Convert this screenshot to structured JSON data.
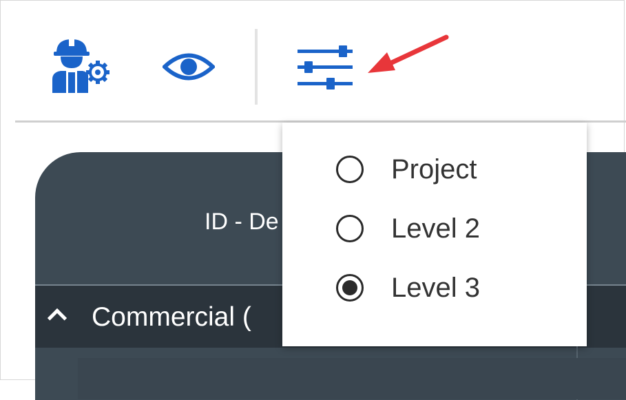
{
  "toolbar": {
    "icons": [
      "engineer-settings-icon",
      "eye-icon",
      "filter-sliders-icon"
    ],
    "accent_color": "#1a63c9",
    "annotation_arrow_color": "#e8363a"
  },
  "panel": {
    "header_text": "ID - De",
    "group_label": "Commercial (",
    "background_color": "#3d4a54"
  },
  "dropdown": {
    "options": [
      {
        "label": "Project",
        "checked": false
      },
      {
        "label": "Level 2",
        "checked": false
      },
      {
        "label": "Level 3",
        "checked": true
      }
    ],
    "selected": "Level 3"
  }
}
